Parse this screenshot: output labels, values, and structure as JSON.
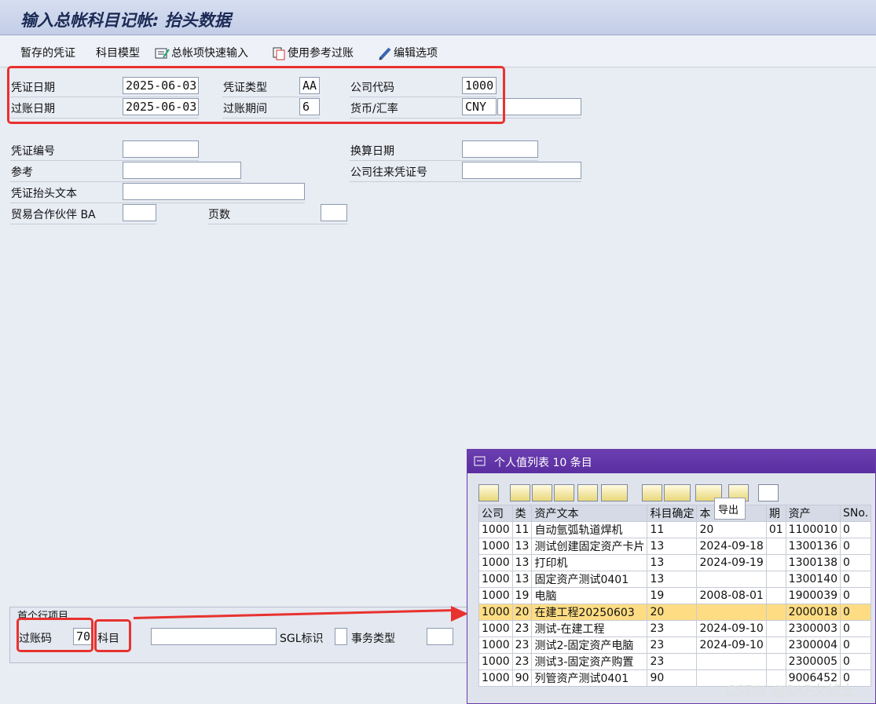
{
  "window": {
    "title": "输入总帐科目记帐: 抬头数据"
  },
  "toolbar": {
    "parked_docs": "暂存的凭证",
    "account_model": "科目模型",
    "gl_fast_entry": "总帐项快速输入",
    "post_with_ref": "使用参考过账",
    "edit_options": "编辑选项"
  },
  "header": {
    "doc_date_label": "凭证日期",
    "doc_date": "2025-06-03",
    "doc_type_label": "凭证类型",
    "doc_type": "AA",
    "company_code_label": "公司代码",
    "company_code": "1000",
    "posting_date_label": "过账日期",
    "posting_date": "2025-06-03",
    "period_label": "过账期间",
    "period": "6",
    "currency_label": "货币/汇率",
    "currency": "CNY"
  },
  "extra": {
    "doc_number_label": "凭证编号",
    "translation_date_label": "换算日期",
    "reference_label": "参考",
    "intercompany_label": "公司往来凭证号",
    "header_text_label": "凭证抬头文本",
    "partner_ba_label": "贸易合作伙伴 BA",
    "pages_label": "页数"
  },
  "first_line": {
    "group_title": "首个行项目",
    "posting_key_label": "过账码",
    "posting_key": "70",
    "account_label": "科目",
    "sgl_label": "SGL标识",
    "trans_type_label": "事务类型"
  },
  "popup": {
    "title": "个人值列表 10 条目",
    "tooltip": "导出",
    "columns": [
      "公司",
      "类",
      "资产文本",
      "科目确定",
      "本",
      "期",
      "资产",
      "SNo."
    ],
    "rows": [
      [
        "1000",
        "11",
        "自动氩弧轨道焊机",
        "11",
        "20",
        "01",
        "1100010",
        "0"
      ],
      [
        "1000",
        "13",
        "测试创建固定资产卡片",
        "13",
        "2024-09-18",
        "",
        "1300136",
        "0"
      ],
      [
        "1000",
        "13",
        "打印机",
        "13",
        "2024-09-19",
        "",
        "1300138",
        "0"
      ],
      [
        "1000",
        "13",
        "固定资产测试0401",
        "13",
        "",
        "",
        "1300140",
        "0"
      ],
      [
        "1000",
        "19",
        "电脑",
        "19",
        "2008-08-01",
        "",
        "1900039",
        "0"
      ],
      [
        "1000",
        "20",
        "在建工程20250603",
        "20",
        "",
        "",
        "2000018",
        "0"
      ],
      [
        "1000",
        "23",
        "测试-在建工程",
        "23",
        "2024-09-10",
        "",
        "2300003",
        "0"
      ],
      [
        "1000",
        "23",
        "测试2-固定资产电脑",
        "23",
        "2024-09-10",
        "",
        "2300004",
        "0"
      ],
      [
        "1000",
        "23",
        "测试3-固定资产购置",
        "23",
        "",
        "",
        "2300005",
        "0"
      ],
      [
        "1000",
        "90",
        "列管资产测试0401",
        "90",
        "",
        "",
        "9006452",
        "0"
      ]
    ],
    "selected_row": 5
  },
  "watermark": "CSDN @SAP女战士"
}
